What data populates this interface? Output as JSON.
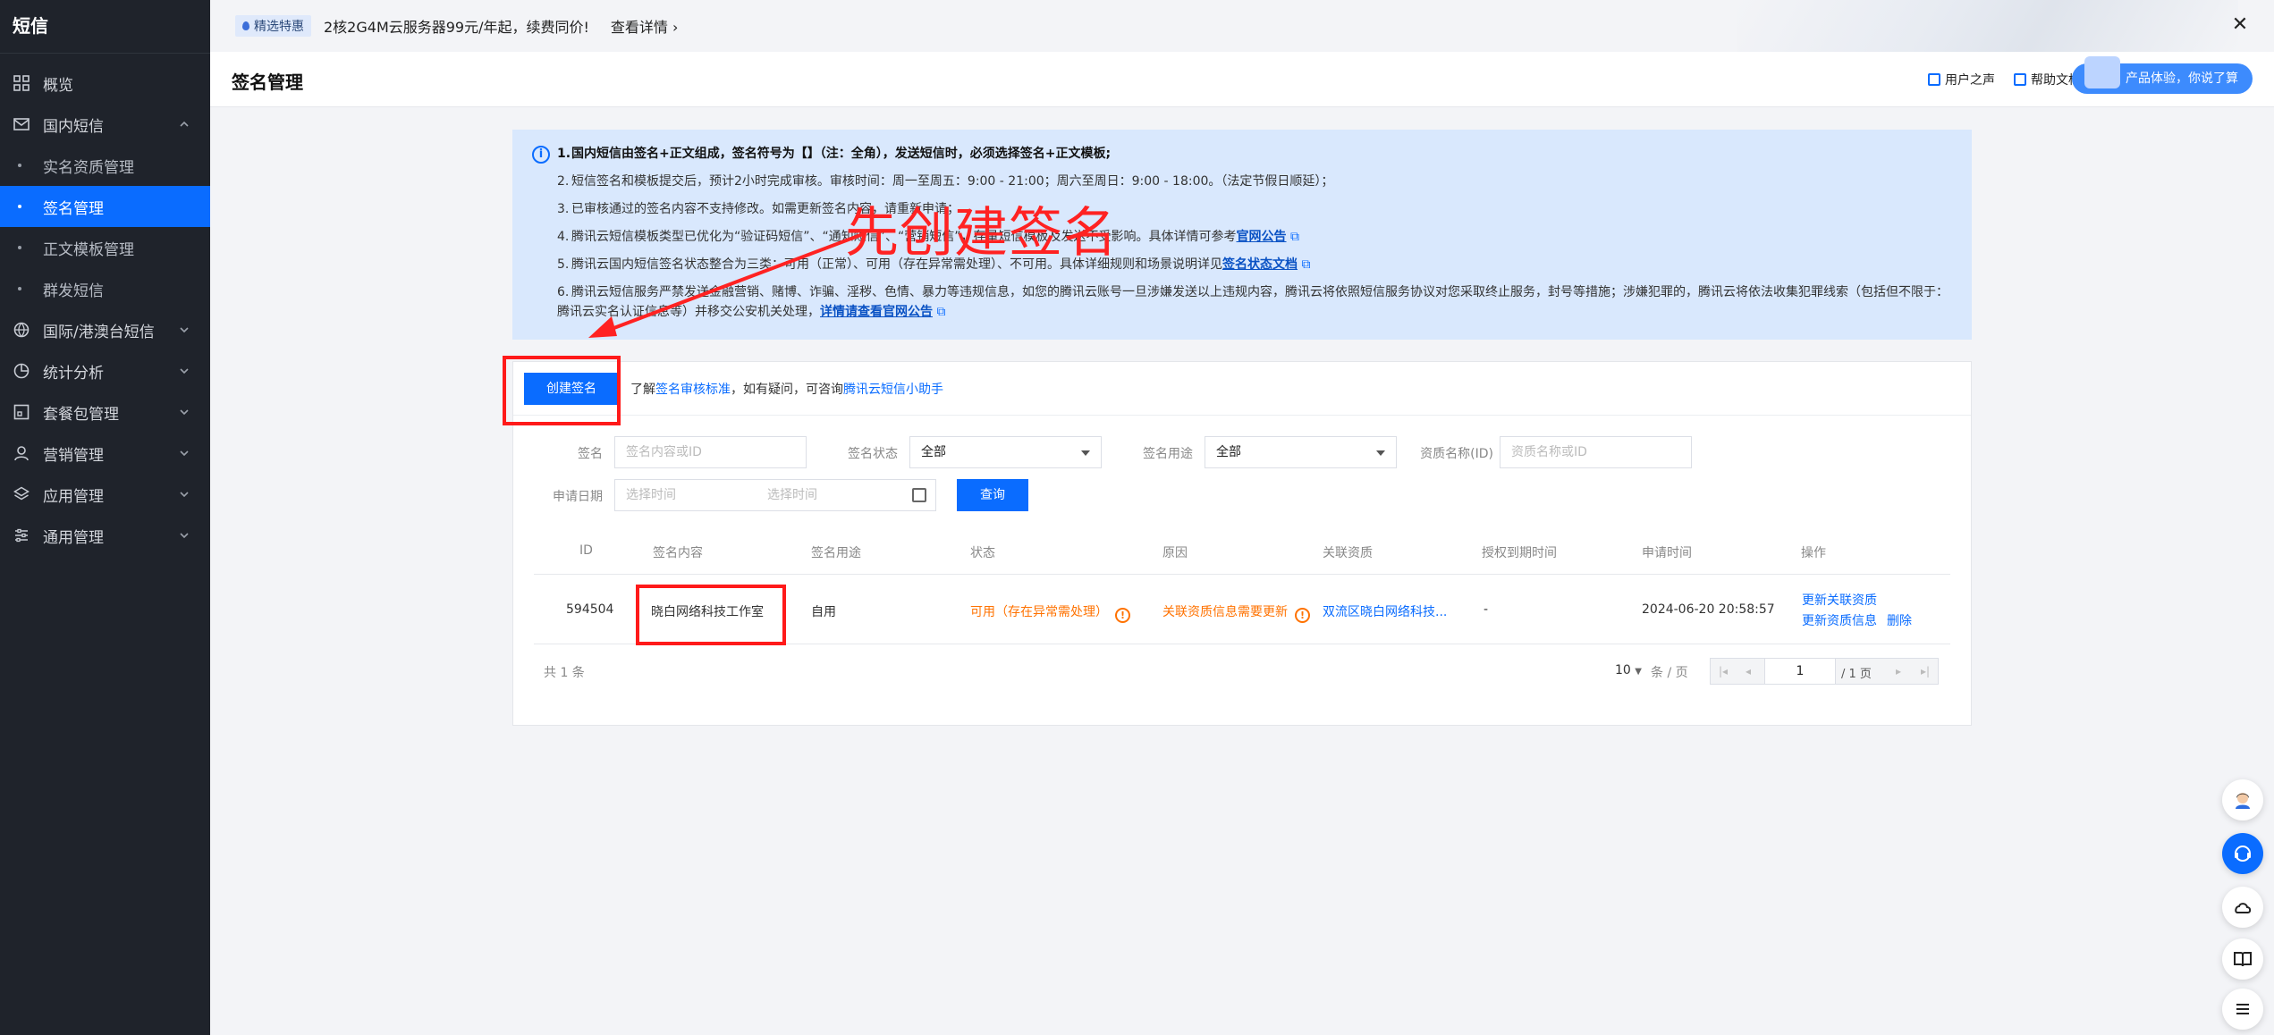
{
  "sidebar": {
    "title": "短信",
    "items": [
      {
        "label": "概览"
      },
      {
        "label": "国内短信"
      },
      {
        "label": "实名资质管理"
      },
      {
        "label": "签名管理"
      },
      {
        "label": "正文模板管理"
      },
      {
        "label": "群发短信"
      },
      {
        "label": "国际/港澳台短信"
      },
      {
        "label": "统计分析"
      },
      {
        "label": "套餐包管理"
      },
      {
        "label": "营销管理"
      },
      {
        "label": "应用管理"
      },
      {
        "label": "通用管理"
      }
    ]
  },
  "banner": {
    "tag": "精选特惠",
    "text": "2核2G4M云服务器99元/年起，续费同价!",
    "link": "查看详情",
    "close": "✕"
  },
  "header": {
    "title": "签名管理",
    "user_voice": "用户之声",
    "help_docs": "帮助文档",
    "feedback_pill": "产品体验，你说了算"
  },
  "notice": {
    "items": [
      {
        "num": "1.",
        "text": "国内短信由签名+正文组成，签名符号为【】（注：全角），发送短信时，必须选择签名+正文模板;"
      },
      {
        "num": "2.",
        "text": "短信签名和模板提交后，预计2小时完成审核。审核时间：周一至周五：9:00 - 21:00；周六至周日：9:00 - 18:00。（法定节假日顺延）；"
      },
      {
        "num": "3.",
        "text": "已审核通过的签名内容不支持修改。如需更新签名内容，请重新申请；"
      },
      {
        "num": "4.",
        "text": "腾讯云短信模板类型已优化为“验证码短信”、“通知短信”、“营销短信”，存量短信模板及发送不受影响。具体详情可参考",
        "link": "官网公告"
      },
      {
        "num": "5.",
        "text": "腾讯云国内短信签名状态整合为三类：可用（正常）、可用（存在异常需处理）、不可用。具体详细规则和场景说明详见",
        "link": "签名状态文档"
      },
      {
        "num": "6.",
        "text": "腾讯云短信服务严禁发送金融营销、赌博、诈骗、淫秽、色情、暴力等违规信息，如您的腾讯云账号一旦涉嫌发送以上违规内容，腾讯云将依照短信服务协议对您采取终止服务，封号等措施；涉嫌犯罪的，腾讯云将依法收集犯罪线索（包括但不限于：腾讯云实名认证信息等）并移交公安机关处理，",
        "link": "详情请查看官网公告"
      }
    ]
  },
  "toolbar": {
    "create_button": "创建签名",
    "hint_prefix": "了解",
    "hint_link1": "签名审核标准",
    "hint_middle": "，如有疑问，可咨询",
    "hint_link2": "腾讯云短信小助手"
  },
  "filters": {
    "sign_label": "签名",
    "sign_placeholder": "签名内容或ID",
    "status_label": "签名状态",
    "status_value": "全部",
    "usage_label": "签名用途",
    "usage_value": "全部",
    "qual_label": "资质名称(ID)",
    "qual_placeholder": "资质名称或ID",
    "date_label": "申请日期",
    "date_start": "选择时间",
    "date_end": "选择时间",
    "query_button": "查询"
  },
  "table": {
    "headers": [
      "ID",
      "签名内容",
      "签名用途",
      "状态",
      "原因",
      "关联资质",
      "授权到期时间",
      "申请时间",
      "操作"
    ],
    "rows": [
      {
        "id": "594504",
        "content": "晓白网络科技工作室",
        "usage": "自用",
        "status": "可用（存在异常需处理）",
        "reason": "关联资质信息需要更新",
        "qualification": "双流区晓白网络科技...",
        "expiry": "-",
        "applied": "2024-06-20 20:58:57",
        "action1": "更新关联资质",
        "action2": "更新资质信息",
        "action3": "删除"
      }
    ]
  },
  "pagination": {
    "total": "共 1 条",
    "page_size": "10",
    "per_page": "条 / 页",
    "current": "1",
    "total_pages": "/ 1 页"
  },
  "annotation": {
    "text": "先创建签名"
  }
}
